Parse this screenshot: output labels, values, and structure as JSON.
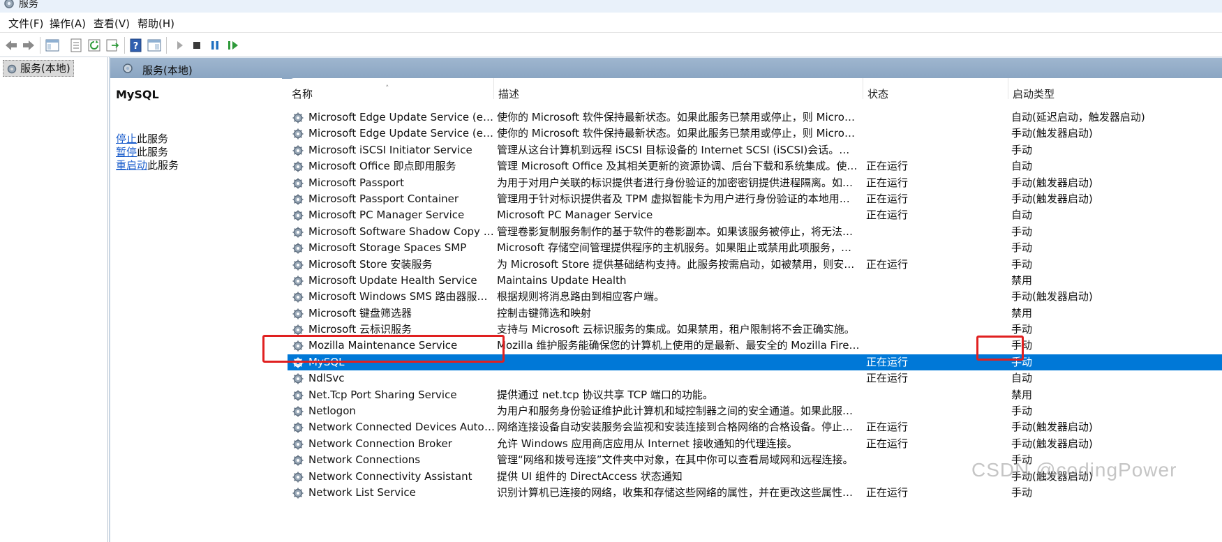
{
  "window": {
    "title": "服务"
  },
  "menu": {
    "file": "文件(F)",
    "action": "操作(A)",
    "view": "查看(V)",
    "help": "帮助(H)"
  },
  "toolbar": {
    "buttons": [
      "back-icon",
      "forward-icon",
      "show-hide-tree-icon",
      "properties-icon",
      "refresh-icon",
      "export-icon",
      "help-icon",
      "console-icon",
      "start-service-icon",
      "stop-service-icon",
      "pause-service-icon",
      "resume-service-icon"
    ]
  },
  "tree": {
    "root_label": "服务(本地)"
  },
  "pane": {
    "header": "服务(本地)",
    "selected_service": "MySQL",
    "actions": [
      {
        "link": "停止",
        "suffix": "此服务"
      },
      {
        "link": "暂停",
        "suffix": "此服务"
      },
      {
        "link": "重启动",
        "suffix": "此服务"
      }
    ]
  },
  "columns": {
    "name": "名称",
    "description": "描述",
    "status": "状态",
    "startup": "启动类型"
  },
  "services": [
    {
      "name": "Microsoft Edge Update Service (edgeupdat...",
      "description": "使你的 Microsoft 软件保持最新状态。如果此服务已禁用或停止，则 Microsoft 软件将...",
      "status": "",
      "startup": "自动(延迟启动，触发器启动)"
    },
    {
      "name": "Microsoft Edge Update Service (edgeupdat...",
      "description": "使你的 Microsoft 软件保持最新状态。如果此服务已禁用或停止，则 Microsoft 软件将...",
      "status": "",
      "startup": "手动(触发器启动)"
    },
    {
      "name": "Microsoft iSCSI Initiator Service",
      "description": "管理从这台计算机到远程 iSCSI 目标设备的 Internet SCSI (iSCSI)会话。如果该服务已...",
      "status": "",
      "startup": "手动"
    },
    {
      "name": "Microsoft Office 即点即用服务",
      "description": "管理 Microsoft Office 及其相关更新的资源协调、后台下载和系统集成。使用任何 Mi...",
      "status": "正在运行",
      "startup": "自动"
    },
    {
      "name": "Microsoft Passport",
      "description": "为用于对用户关联的标识提供者进行身份验证的加密密钥提供进程隔离。如果禁用了...",
      "status": "正在运行",
      "startup": "手动(触发器启动)"
    },
    {
      "name": "Microsoft Passport Container",
      "description": "管理用于针对标识提供者及 TPM 虚拟智能卡为用户进行身份验证的本地用户标识密钥...",
      "status": "正在运行",
      "startup": "手动(触发器启动)"
    },
    {
      "name": "Microsoft PC Manager Service",
      "description": "Microsoft PC Manager Service",
      "status": "正在运行",
      "startup": "自动"
    },
    {
      "name": "Microsoft Software Shadow Copy Provider",
      "description": "管理卷影复制服务制作的基于软件的卷影副本。如果该服务被停止，将无法管理基于...",
      "status": "",
      "startup": "手动"
    },
    {
      "name": "Microsoft Storage Spaces SMP",
      "description": "Microsoft 存储空间管理提供程序的主机服务。如果阻止或禁用此项服务，则无法管理...",
      "status": "",
      "startup": "手动"
    },
    {
      "name": "Microsoft Store 安装服务",
      "description": "为 Microsoft Store 提供基础结构支持。此服务按需启动，如被禁用，则安装将无法正...",
      "status": "正在运行",
      "startup": "手动"
    },
    {
      "name": "Microsoft Update Health Service",
      "description": "Maintains Update Health",
      "status": "",
      "startup": "禁用"
    },
    {
      "name": "Microsoft Windows SMS 路由器服务。",
      "description": "根据规则将消息路由到相应客户端。",
      "status": "",
      "startup": "手动(触发器启动)"
    },
    {
      "name": "Microsoft 键盘筛选器",
      "description": "控制击键筛选和映射",
      "status": "",
      "startup": "禁用"
    },
    {
      "name": "Microsoft 云标识服务",
      "description": "支持与 Microsoft 云标识服务的集成。如果禁用，租户限制将不会正确实施。",
      "status": "",
      "startup": "手动"
    },
    {
      "name": "Mozilla Maintenance Service",
      "description": "Mozilla 维护服务能确保您的计算机上使用的是最新、最安全的 Mozilla Firefox 版本。...",
      "status": "",
      "startup": "手动"
    },
    {
      "name": "MySQL",
      "description": "",
      "status": "正在运行",
      "startup": "手动",
      "selected": true
    },
    {
      "name": "NdlSvc",
      "description": "",
      "status": "正在运行",
      "startup": "自动"
    },
    {
      "name": "Net.Tcp Port Sharing Service",
      "description": "提供通过 net.tcp 协议共享 TCP 端口的功能。",
      "status": "",
      "startup": "禁用"
    },
    {
      "name": "Netlogon",
      "description": "为用户和服务身份验证维护此计算机和域控制器之间的安全通道。如果此服务被停用...",
      "status": "",
      "startup": "手动"
    },
    {
      "name": "Network Connected Devices Auto-Setup",
      "description": "网络连接设备自动安装服务会监视和安装连接到合格网络的合格设备。停止或禁用此...",
      "status": "正在运行",
      "startup": "手动(触发器启动)"
    },
    {
      "name": "Network Connection Broker",
      "description": "允许 Windows 应用商店应用从 Internet 接收通知的代理连接。",
      "status": "正在运行",
      "startup": "手动(触发器启动)"
    },
    {
      "name": "Network Connections",
      "description": "管理“网络和拨号连接”文件夹中对象，在其中你可以查看局域网和远程连接。",
      "status": "",
      "startup": "手动"
    },
    {
      "name": "Network Connectivity Assistant",
      "description": "提供 UI 组件的 DirectAccess 状态通知",
      "status": "",
      "startup": "手动(触发器启动)"
    },
    {
      "name": "Network List Service",
      "description": "识别计算机已连接的网络，收集和存储这些网络的属性，并在更改这些属性时通知应...",
      "status": "正在运行",
      "startup": "手动"
    }
  ],
  "watermark": "CSDN @codingPower",
  "colors": {
    "selection": "#0078d7",
    "highlight_box": "#e02020",
    "header_band": "#9fb6cf"
  }
}
